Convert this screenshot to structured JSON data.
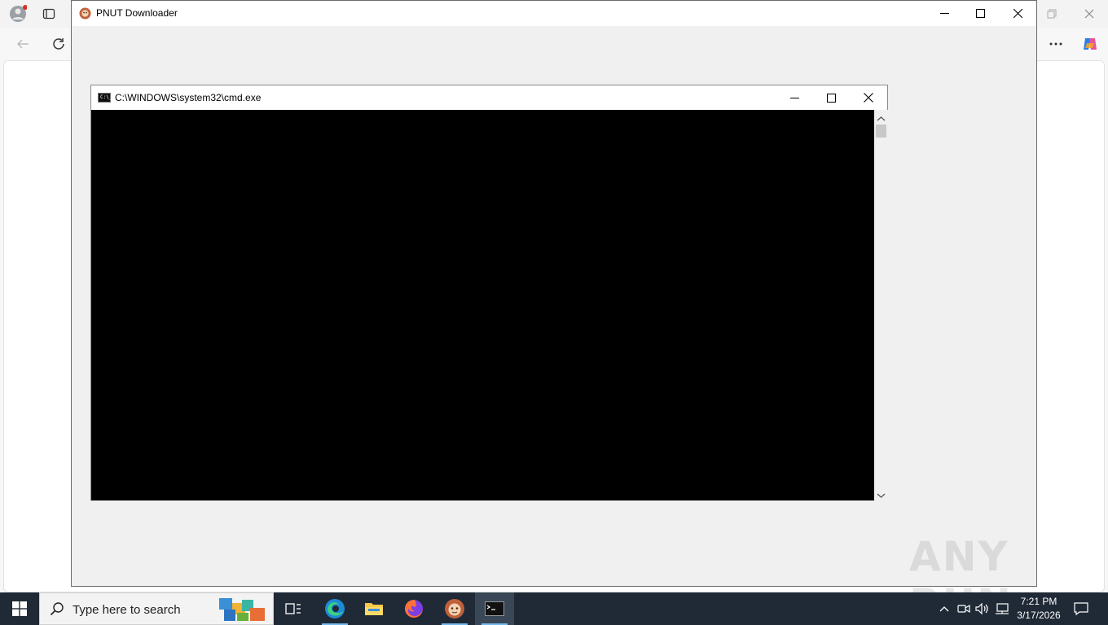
{
  "pnut_window": {
    "title": "PNUT Downloader"
  },
  "cmd_window": {
    "title": "C:\\WINDOWS\\system32\\cmd.exe",
    "icon_text": "C:\\_"
  },
  "taskbar": {
    "search_placeholder": "Type here to search",
    "clock_time": "7:21 PM",
    "clock_date": "3/17/2026"
  },
  "watermark": "ANY RUN",
  "icons": {
    "browser": [
      "profile-icon",
      "tab-actions-icon",
      "back-icon",
      "refresh-icon",
      "more-icon",
      "copilot-icon",
      "restore-icon",
      "close-icon"
    ],
    "taskbar": [
      "windows-start-icon",
      "search-icon",
      "task-view-icon",
      "edge-icon",
      "file-explorer-icon",
      "firefox-icon",
      "pnut-app-icon",
      "cmd-app-icon"
    ],
    "tray": [
      "chevron-up-icon",
      "meet-now-icon",
      "volume-icon",
      "network-icon",
      "notification-icon"
    ]
  },
  "colors": {
    "taskbar": "#1f2a36",
    "console": "#000000",
    "window_bg": "#f0f0f0",
    "accent": "#76b9ed"
  }
}
